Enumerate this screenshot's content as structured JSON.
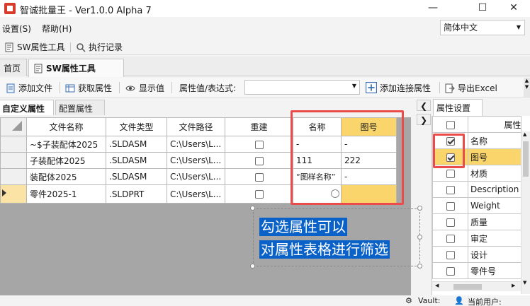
{
  "window": {
    "title": "智诚批量王 - Ver1.0.0 Alpha 7",
    "minimize": "—",
    "maximize": "☐",
    "close": "✕"
  },
  "menu": {
    "settings": "设置(S)",
    "help": "帮助(H)",
    "language": "简体中文"
  },
  "toolstrip": {
    "sw_tool": "SW属性工具",
    "history": "执行记录"
  },
  "doc_tabs": {
    "home": "首页",
    "sw_tool": "SW属性工具"
  },
  "commands": {
    "add_file": "添加文件",
    "get_props": "获取属性",
    "show_value": "显示值",
    "expr_label": "属性值/表达式:",
    "expr_value": "",
    "add_link_prop": "添加连接属性",
    "export_excel": "导出Excel"
  },
  "sub_tabs": {
    "custom": "自定义属性",
    "config": "配置属性"
  },
  "grid": {
    "columns": [
      "文件名称",
      "文件类型",
      "文件路径",
      "重建",
      "名称",
      "图号"
    ],
    "rows": [
      {
        "name": "~$子装配体2025",
        "type": ".SLDASM",
        "path": "C:\\Users\\L...",
        "rebuild": false,
        "title": "-",
        "drawing_no": "-"
      },
      {
        "name": "子装配体2025",
        "type": ".SLDASM",
        "path": "C:\\Users\\L...",
        "rebuild": false,
        "title": "111",
        "drawing_no": "222"
      },
      {
        "name": "装配体2025",
        "type": ".SLDASM",
        "path": "C:\\Users\\L...",
        "rebuild": false,
        "title": "“图样名称”",
        "drawing_no": "-"
      },
      {
        "name": "零件2025-1",
        "type": ".SLDPRT",
        "path": "C:\\Users\\L...",
        "rebuild": false,
        "title": "",
        "drawing_no": ""
      }
    ]
  },
  "annotation": {
    "line1": "勾选属性可以",
    "line2": "对属性表格进行筛选"
  },
  "prop_panel": {
    "tab": "属性设置",
    "header": "属性",
    "items": [
      {
        "label": "名称",
        "checked": true
      },
      {
        "label": "图号",
        "checked": true
      },
      {
        "label": "材质",
        "checked": false
      },
      {
        "label": "Description",
        "checked": false
      },
      {
        "label": "Weight",
        "checked": false
      },
      {
        "label": "质量",
        "checked": false
      },
      {
        "label": "审定",
        "checked": false
      },
      {
        "label": "设计",
        "checked": false
      },
      {
        "label": "零件号",
        "checked": false
      }
    ]
  },
  "status": {
    "vault": "Vault:",
    "user": "当前用户:"
  },
  "colors": {
    "highlight_red": "#ea4b4b",
    "selected_yellow": "#f9d56b",
    "annotation_blue": "#0a62c9"
  }
}
